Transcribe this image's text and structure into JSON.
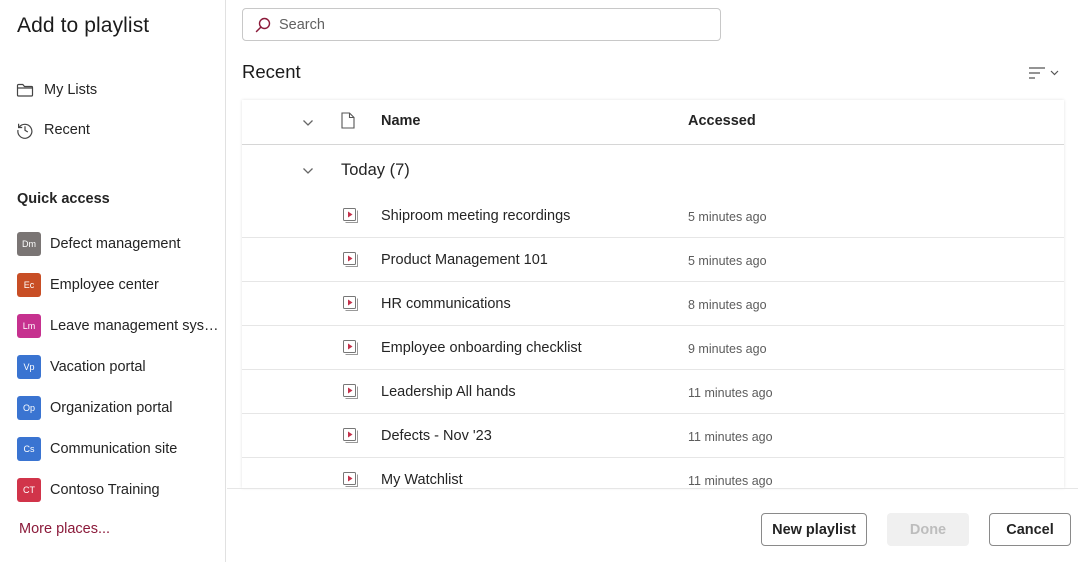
{
  "dialog": {
    "title": "Add to playlist"
  },
  "sidebar": {
    "nav": [
      {
        "label": "My Lists",
        "icon": "folder-icon"
      },
      {
        "label": "Recent",
        "icon": "history-icon"
      }
    ],
    "quick_access_title": "Quick access",
    "quick_access": [
      {
        "abbr": "Dm",
        "label": "Defect management",
        "color": "#7a7574"
      },
      {
        "abbr": "Ec",
        "label": "Employee center",
        "color": "#c84e25"
      },
      {
        "abbr": "Lm",
        "label": "Leave management system",
        "color": "#c6318f"
      },
      {
        "abbr": "Vp",
        "label": "Vacation portal",
        "color": "#3a74d1"
      },
      {
        "abbr": "Op",
        "label": "Organization portal",
        "color": "#3a74d1"
      },
      {
        "abbr": "Cs",
        "label": "Communication site",
        "color": "#3a74d1"
      },
      {
        "abbr": "CT",
        "label": "Contoso Training",
        "color": "#d1344a"
      }
    ],
    "more_places": "More places..."
  },
  "search": {
    "placeholder": "Search",
    "value": ""
  },
  "main": {
    "section_title": "Recent",
    "columns": {
      "name": "Name",
      "accessed": "Accessed"
    },
    "group": {
      "label": "Today (7)"
    },
    "rows": [
      {
        "name": "Shiproom meeting recordings",
        "accessed": "5 minutes ago"
      },
      {
        "name": "Product Management 101",
        "accessed": "5 minutes ago"
      },
      {
        "name": "HR communications",
        "accessed": "8 minutes ago"
      },
      {
        "name": "Employee onboarding checklist",
        "accessed": "9 minutes ago"
      },
      {
        "name": "Leadership All hands",
        "accessed": "11 minutes ago"
      },
      {
        "name": "Defects - Nov '23",
        "accessed": "11 minutes ago"
      },
      {
        "name": "My Watchlist",
        "accessed": "11 minutes ago"
      }
    ]
  },
  "footer": {
    "new_playlist": "New playlist",
    "done": "Done",
    "cancel": "Cancel"
  },
  "colors": {
    "accent": "#8b1a3a",
    "playlist_icon": "#c4314b"
  }
}
